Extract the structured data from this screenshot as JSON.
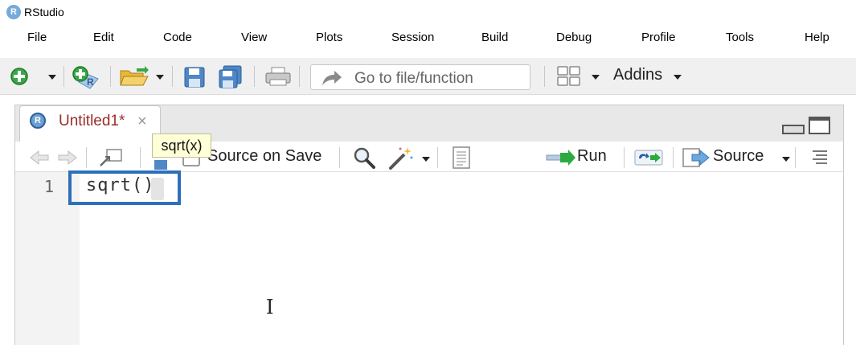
{
  "app": {
    "title": "RStudio",
    "logo_letter": "R"
  },
  "menu": [
    "File",
    "Edit",
    "Code",
    "View",
    "Plots",
    "Session",
    "Build",
    "Debug",
    "Profile",
    "Tools",
    "Help"
  ],
  "toolbar": {
    "goto_placeholder": "Go to file/function",
    "addins_label": "Addins"
  },
  "editor": {
    "tab_label": "Untitled1*",
    "tab_close": "×",
    "tab_logo_letter": "R",
    "source_on_save_label": "Source on Save",
    "run_label": "Run",
    "source_label": "Source",
    "tooltip": "sqrt(x)",
    "line_number": "1",
    "code_line": "sqrt()"
  },
  "colors": {
    "accent_blue": "#2c6fbb",
    "tab_label_red": "#9d2b2b",
    "tooltip_bg": "#ffffd8"
  },
  "icons": [
    "new-file-icon",
    "new-project-icon",
    "open-folder-icon",
    "save-icon",
    "save-all-icon",
    "print-icon",
    "goto-arrow-icon",
    "grid-layout-icon",
    "back-arrow-icon",
    "forward-arrow-icon",
    "show-in-window-icon",
    "search-icon",
    "magic-wand-icon",
    "compile-notebook-icon",
    "run-icon",
    "rerun-icon",
    "source-icon",
    "outline-icon",
    "text-cursor-icon"
  ]
}
